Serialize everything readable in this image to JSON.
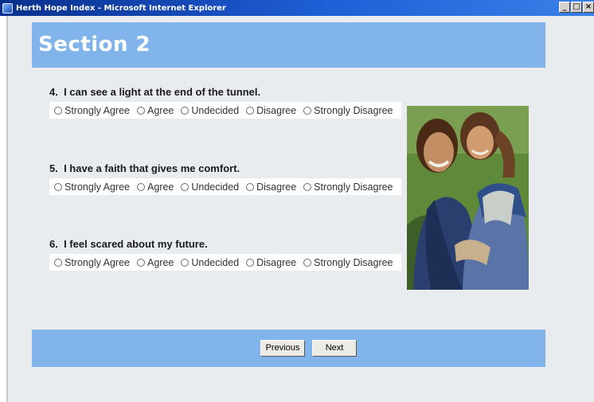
{
  "window": {
    "title": "Herth Hope Index - Microsoft Internet Explorer",
    "controls": {
      "minimize": "_",
      "maximize": "□",
      "close": "×"
    }
  },
  "section": {
    "title": "Section 2"
  },
  "questions": [
    {
      "number": "4.",
      "text": "I can see a light at the end of the tunnel.",
      "options": [
        "Strongly Agree",
        "Agree",
        "Undecided",
        "Disagree",
        "Strongly Disagree"
      ],
      "selected": null
    },
    {
      "number": "5.",
      "text": "I have a faith that gives me comfort.",
      "options": [
        "Strongly Agree",
        "Agree",
        "Undecided",
        "Disagree",
        "Strongly Disagree"
      ],
      "selected": null
    },
    {
      "number": "6.",
      "text": "I feel scared about my future.",
      "options": [
        "Strongly Agree",
        "Agree",
        "Undecided",
        "Disagree",
        "Strongly Disagree"
      ],
      "selected": null
    }
  ],
  "navigation": {
    "previous_label": "Previous",
    "next_label": "Next"
  },
  "colors": {
    "header_band": "#80b4ea",
    "page_background": "#e9ecef",
    "titlebar": "#1e5fd6"
  }
}
